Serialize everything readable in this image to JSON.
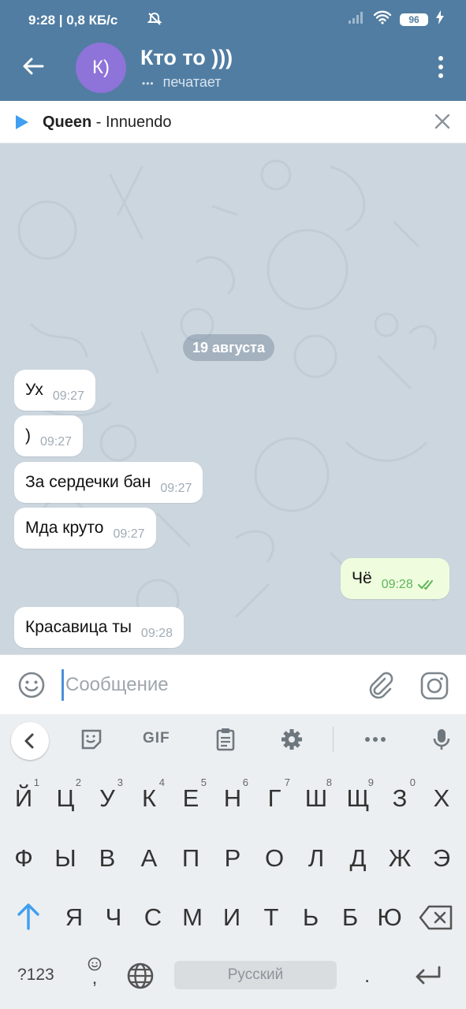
{
  "status_bar": {
    "time_net": "9:28 | 0,8 КБ/с",
    "battery": "96"
  },
  "header": {
    "avatar_initials": "К)",
    "title": "Кто то )))",
    "status_dots": "•••",
    "status": "печатает"
  },
  "music": {
    "artist": "Queen",
    "separator": " - ",
    "title": "Innuendo"
  },
  "chat": {
    "date": "19 августа",
    "messages": [
      {
        "text": "Ух",
        "time": "09:27"
      },
      {
        "text": ")",
        "time": "09:27"
      },
      {
        "text": "За сердечки бан",
        "time": "09:27"
      },
      {
        "text": "Мда круто",
        "time": "09:27"
      },
      {
        "text": "Чё",
        "time": "09:28"
      },
      {
        "text": "Красавица ты",
        "time": "09:28"
      }
    ]
  },
  "input": {
    "placeholder": "Сообщение"
  },
  "keyboard": {
    "gif_label": "GIF",
    "row1": [
      "Й",
      "Ц",
      "У",
      "К",
      "Е",
      "Н",
      "Г",
      "Ш",
      "Щ",
      "З",
      "Х"
    ],
    "row1_hints": [
      "1",
      "2",
      "3",
      "4",
      "5",
      "6",
      "7",
      "8",
      "9",
      "0"
    ],
    "row2": [
      "Ф",
      "Ы",
      "В",
      "А",
      "П",
      "Р",
      "О",
      "Л",
      "Д",
      "Ж",
      "Э"
    ],
    "row3": [
      "Я",
      "Ч",
      "С",
      "М",
      "И",
      "Т",
      "Ь",
      "Б",
      "Ю"
    ],
    "symbols_key": "?123",
    "comma_key": ",",
    "space_label": "Русский",
    "period_key": "."
  },
  "colors": {
    "header": "#517da2",
    "chat_bg": "#ccd6de",
    "avatar": "#8e73d9",
    "out_bubble": "#effdde",
    "accent": "#3f9ff0"
  }
}
